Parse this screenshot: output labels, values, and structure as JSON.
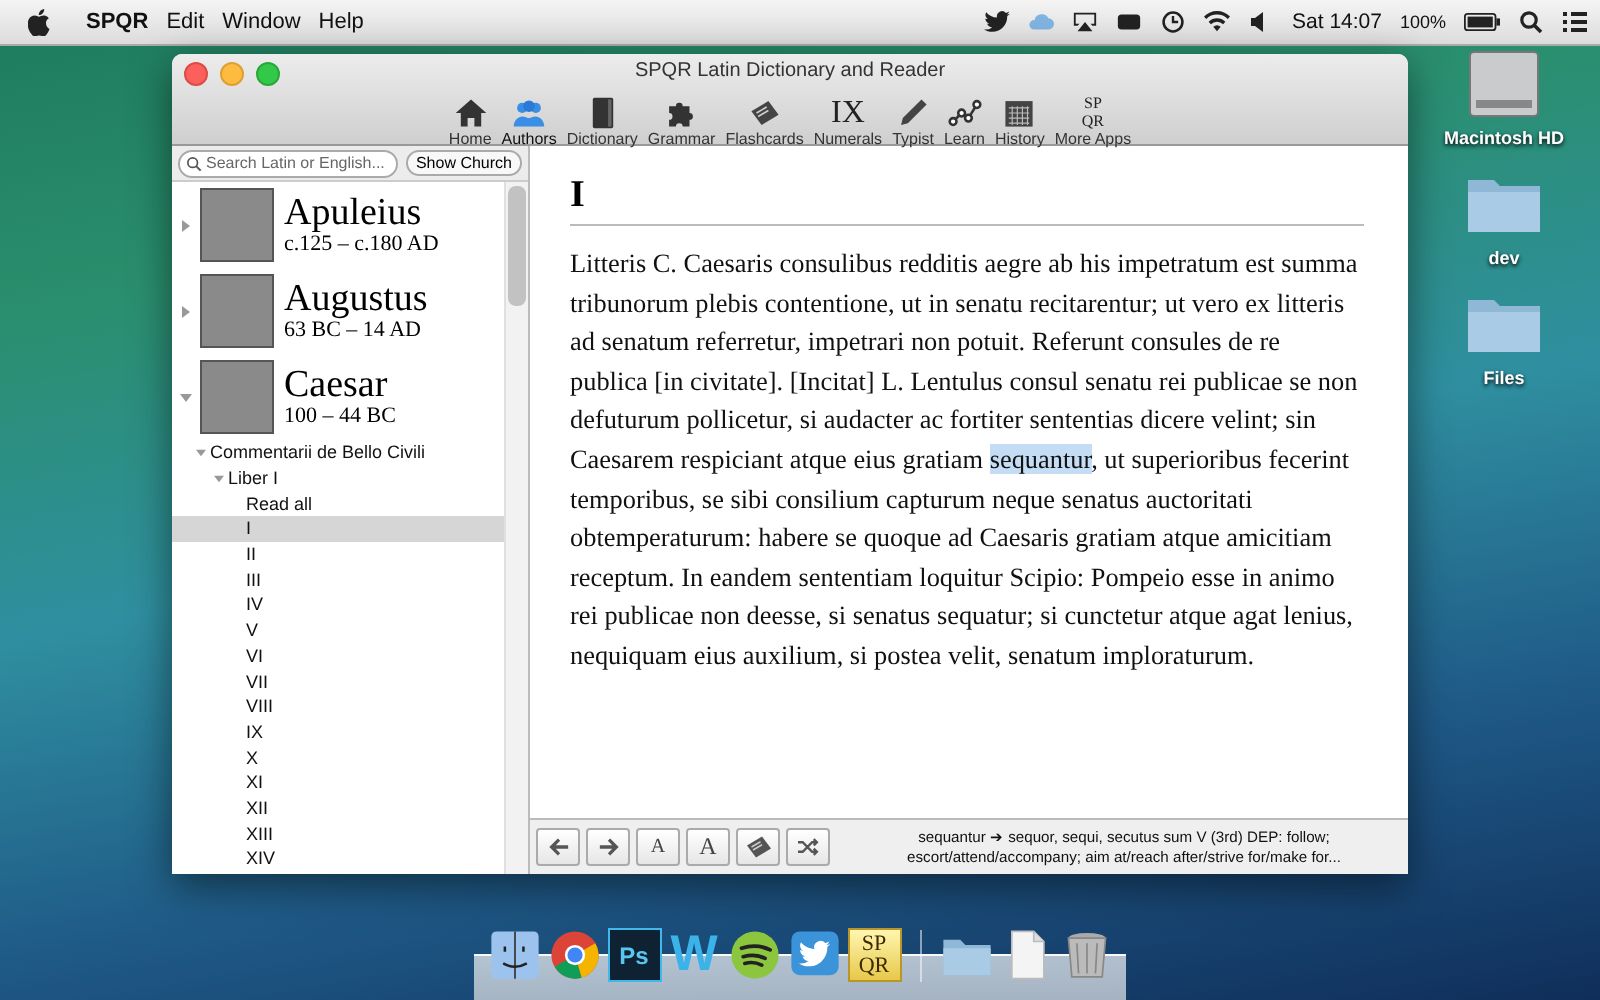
{
  "menu_bar": {
    "app_name": "SPQR",
    "menus": [
      "Edit",
      "Window",
      "Help"
    ],
    "clock": "Sat 14:07",
    "battery": "100%"
  },
  "desktop_icons": [
    {
      "kind": "drive",
      "label": "Macintosh HD"
    },
    {
      "kind": "folder",
      "label": "dev"
    },
    {
      "kind": "folder",
      "label": "Files"
    }
  ],
  "window": {
    "title": "SPQR Latin Dictionary and Reader"
  },
  "toolbar": [
    {
      "kind": "home",
      "label": "Home",
      "selected": false
    },
    {
      "kind": "authors",
      "label": "Authors",
      "selected": true
    },
    {
      "kind": "dictionary",
      "label": "Dictionary",
      "selected": false
    },
    {
      "kind": "grammar",
      "label": "Grammar",
      "selected": false
    },
    {
      "kind": "flashcards",
      "label": "Flashcards",
      "selected": false
    },
    {
      "kind": "glyph",
      "glyph": "IX",
      "label": "Numerals",
      "selected": false
    },
    {
      "kind": "typist",
      "label": "Typist",
      "selected": false
    },
    {
      "kind": "learn",
      "label": "Learn",
      "selected": false
    },
    {
      "kind": "history",
      "label": "History",
      "selected": false
    },
    {
      "kind": "glyph_stack",
      "glyph": "SPQR",
      "label": "More Apps",
      "selected": false
    }
  ],
  "sidebar": {
    "search": {
      "placeholder": "Search Latin or English..."
    },
    "show_church_button": "Show Church",
    "authors": [
      {
        "name": "Apuleius",
        "dates": "c.125 – c.180 AD",
        "expanded": false
      },
      {
        "name": "Augustus",
        "dates": "63 BC – 14 AD",
        "expanded": false
      },
      {
        "name": "Caesar",
        "dates": "100 – 44 BC",
        "expanded": true,
        "children": [
          {
            "label": "Commentarii de Bello Civili",
            "expanded": true,
            "children": [
              {
                "label": "Liber I",
                "expanded": true,
                "children": [
                  {
                    "label": "Read all",
                    "selected": false
                  },
                  {
                    "label": "I",
                    "selected": true
                  },
                  {
                    "label": "II",
                    "selected": false
                  },
                  {
                    "label": "III",
                    "selected": false
                  },
                  {
                    "label": "IV",
                    "selected": false
                  },
                  {
                    "label": "V",
                    "selected": false
                  },
                  {
                    "label": "VI",
                    "selected": false
                  },
                  {
                    "label": "VII",
                    "selected": false
                  },
                  {
                    "label": "VIII",
                    "selected": false
                  },
                  {
                    "label": "IX",
                    "selected": false
                  },
                  {
                    "label": "X",
                    "selected": false
                  },
                  {
                    "label": "XI",
                    "selected": false
                  },
                  {
                    "label": "XII",
                    "selected": false
                  },
                  {
                    "label": "XIII",
                    "selected": false
                  },
                  {
                    "label": "XIV",
                    "selected": false
                  }
                ]
              }
            ]
          }
        ]
      }
    ]
  },
  "reader": {
    "heading": "I",
    "text_parts": [
      {
        "text": "Litteris C. Caesaris consulibus redditis aegre ab his impetratum est summa tribunorum plebis contentione, ut in senatu recitarentur; ut vero ex litteris ad senatum referretur, impetrari non potuit. Referunt consules de re publica [in civitate]. [Incitat] L. Lentulus consul senatu rei publicae se non defuturum pollicetur, si audacter ac fortiter sententias dicere velint; sin Caesarem respiciant atque eius gratiam ",
        "selected": false
      },
      {
        "text": "sequantur",
        "selected": true
      },
      {
        "text": ", ut superioribus fecerint temporibus, se sibi consilium capturum neque senatus auctoritati obtemperaturum: habere se quoque ad Caesaris gratiam atque amicitiam receptum. In eandem sententiam loquitur Scipio: Pompeio esse in animo rei publicae non deesse, si senatus sequatur; si cunctetur atque agat lenius, nequiquam eius auxilium, si postea velit, senatum imploraturum.",
        "selected": false
      }
    ],
    "footer_buttons": [
      {
        "kind": "back"
      },
      {
        "kind": "forward"
      },
      {
        "kind": "smaller_text",
        "glyph": "A"
      },
      {
        "kind": "larger_text",
        "glyph": "A"
      },
      {
        "kind": "flashcard"
      },
      {
        "kind": "shuffle"
      }
    ],
    "definition": "sequantur ➔ sequor, sequi, secutus sum  V (3rd) DEP: follow; escort/attend/accompany; aim at/reach after/strive for/make for..."
  },
  "dock": [
    {
      "kind": "finder"
    },
    {
      "kind": "chrome"
    },
    {
      "kind": "glyph_box",
      "glyph": "Ps"
    },
    {
      "kind": "glyph_w",
      "glyph": "W"
    },
    {
      "kind": "spotify"
    },
    {
      "kind": "twitter"
    },
    {
      "kind": "glyph_stack",
      "glyph": "SPQR"
    },
    {
      "kind": "separator"
    },
    {
      "kind": "folder"
    },
    {
      "kind": "document"
    },
    {
      "kind": "trash"
    }
  ]
}
